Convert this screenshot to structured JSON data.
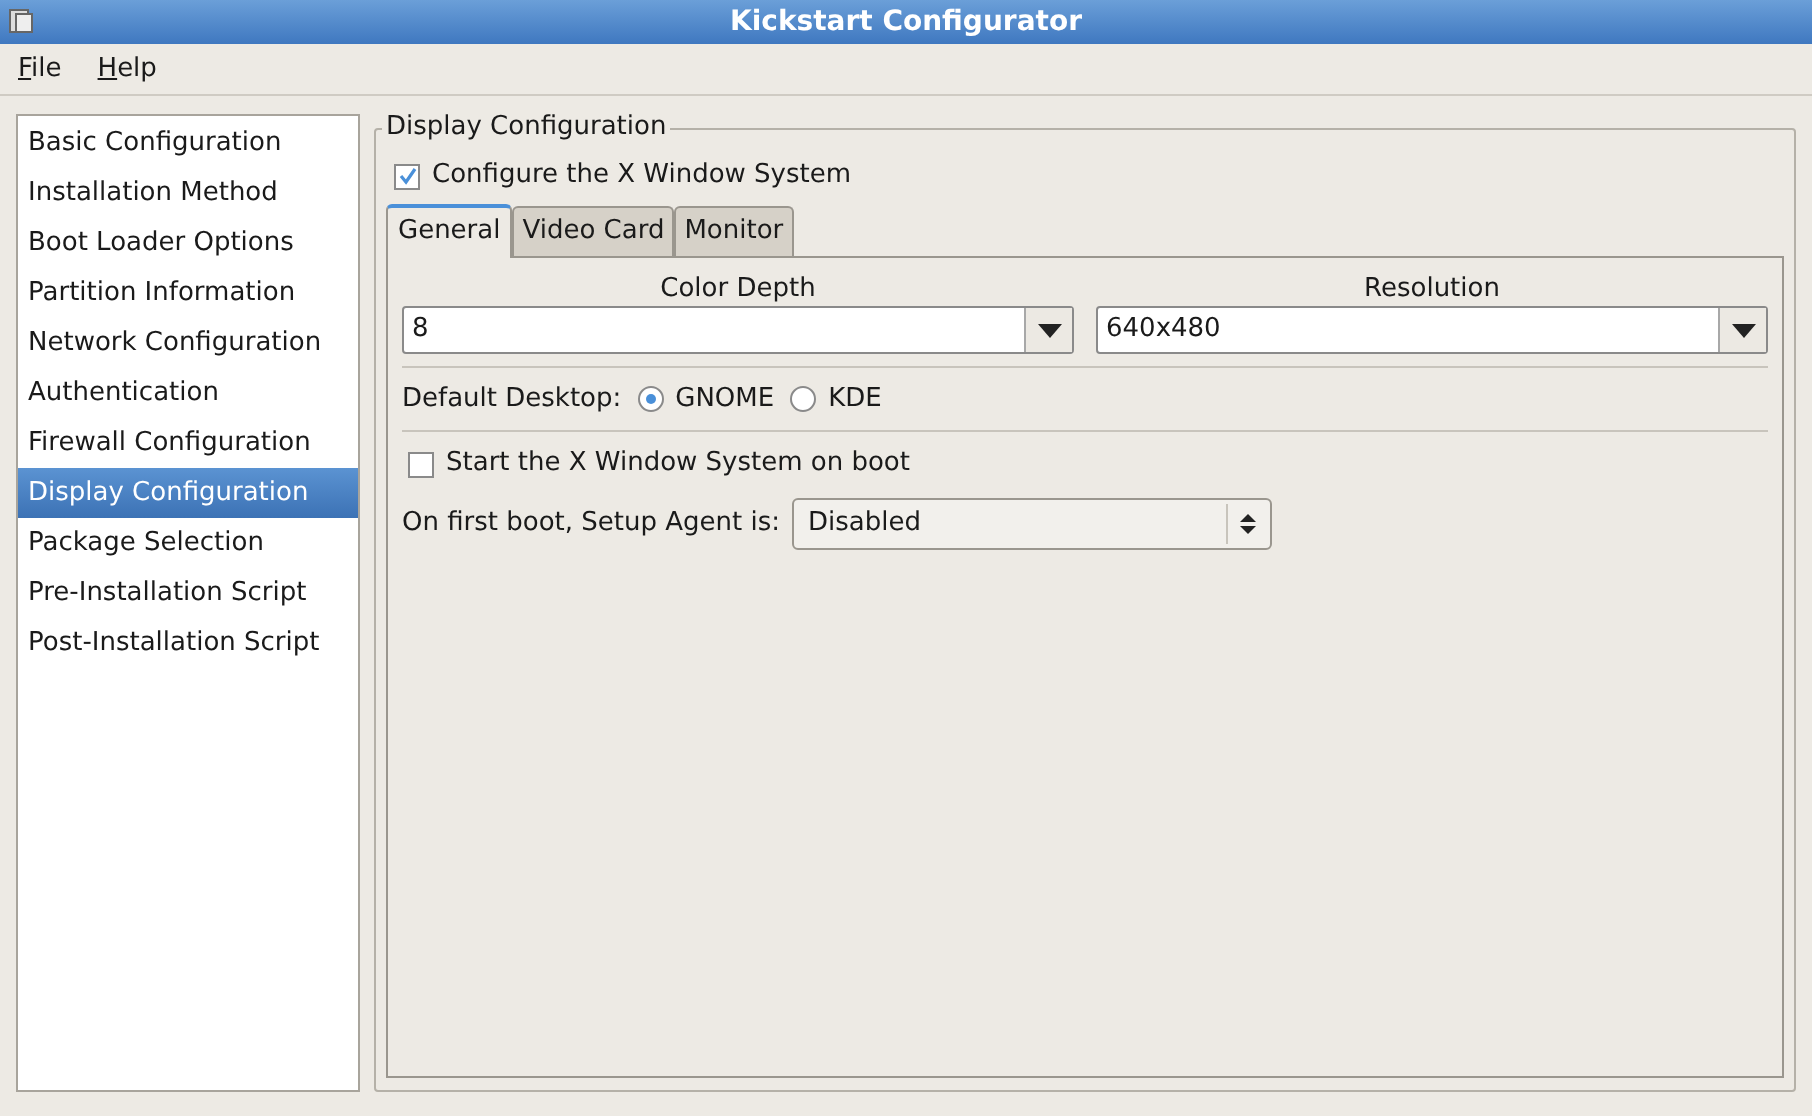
{
  "window": {
    "title": "Kickstart Configurator"
  },
  "menu": [
    "File",
    "Help"
  ],
  "sidebar": {
    "items": [
      {
        "label": "Basic Configuration",
        "selected": false
      },
      {
        "label": "Installation Method",
        "selected": false
      },
      {
        "label": "Boot Loader Options",
        "selected": false
      },
      {
        "label": "Partition Information",
        "selected": false
      },
      {
        "label": "Network Configuration",
        "selected": false
      },
      {
        "label": "Authentication",
        "selected": false
      },
      {
        "label": "Firewall Configuration",
        "selected": false
      },
      {
        "label": "Display Configuration",
        "selected": true
      },
      {
        "label": "Package Selection",
        "selected": false
      },
      {
        "label": "Pre-Installation Script",
        "selected": false
      },
      {
        "label": "Post-Installation Script",
        "selected": false
      }
    ]
  },
  "panel": {
    "title": "Display Configuration",
    "configure_x": {
      "label": "Configure the X Window System",
      "checked": true
    },
    "tabs": [
      {
        "label": "General",
        "selected": true
      },
      {
        "label": "Video Card",
        "selected": false
      },
      {
        "label": "Monitor",
        "selected": false
      }
    ],
    "color_depth": {
      "label": "Color Depth",
      "value": "8"
    },
    "resolution": {
      "label": "Resolution",
      "value": "640x480"
    },
    "default_desktop": {
      "label": "Default Desktop:",
      "options": [
        {
          "label": "GNOME",
          "selected": true
        },
        {
          "label": "KDE",
          "selected": false
        }
      ]
    },
    "start_on_boot": {
      "label": "Start the X Window System on boot",
      "checked": false
    },
    "setup_agent": {
      "label": "On first boot, Setup Agent is:",
      "value": "Disabled"
    }
  }
}
